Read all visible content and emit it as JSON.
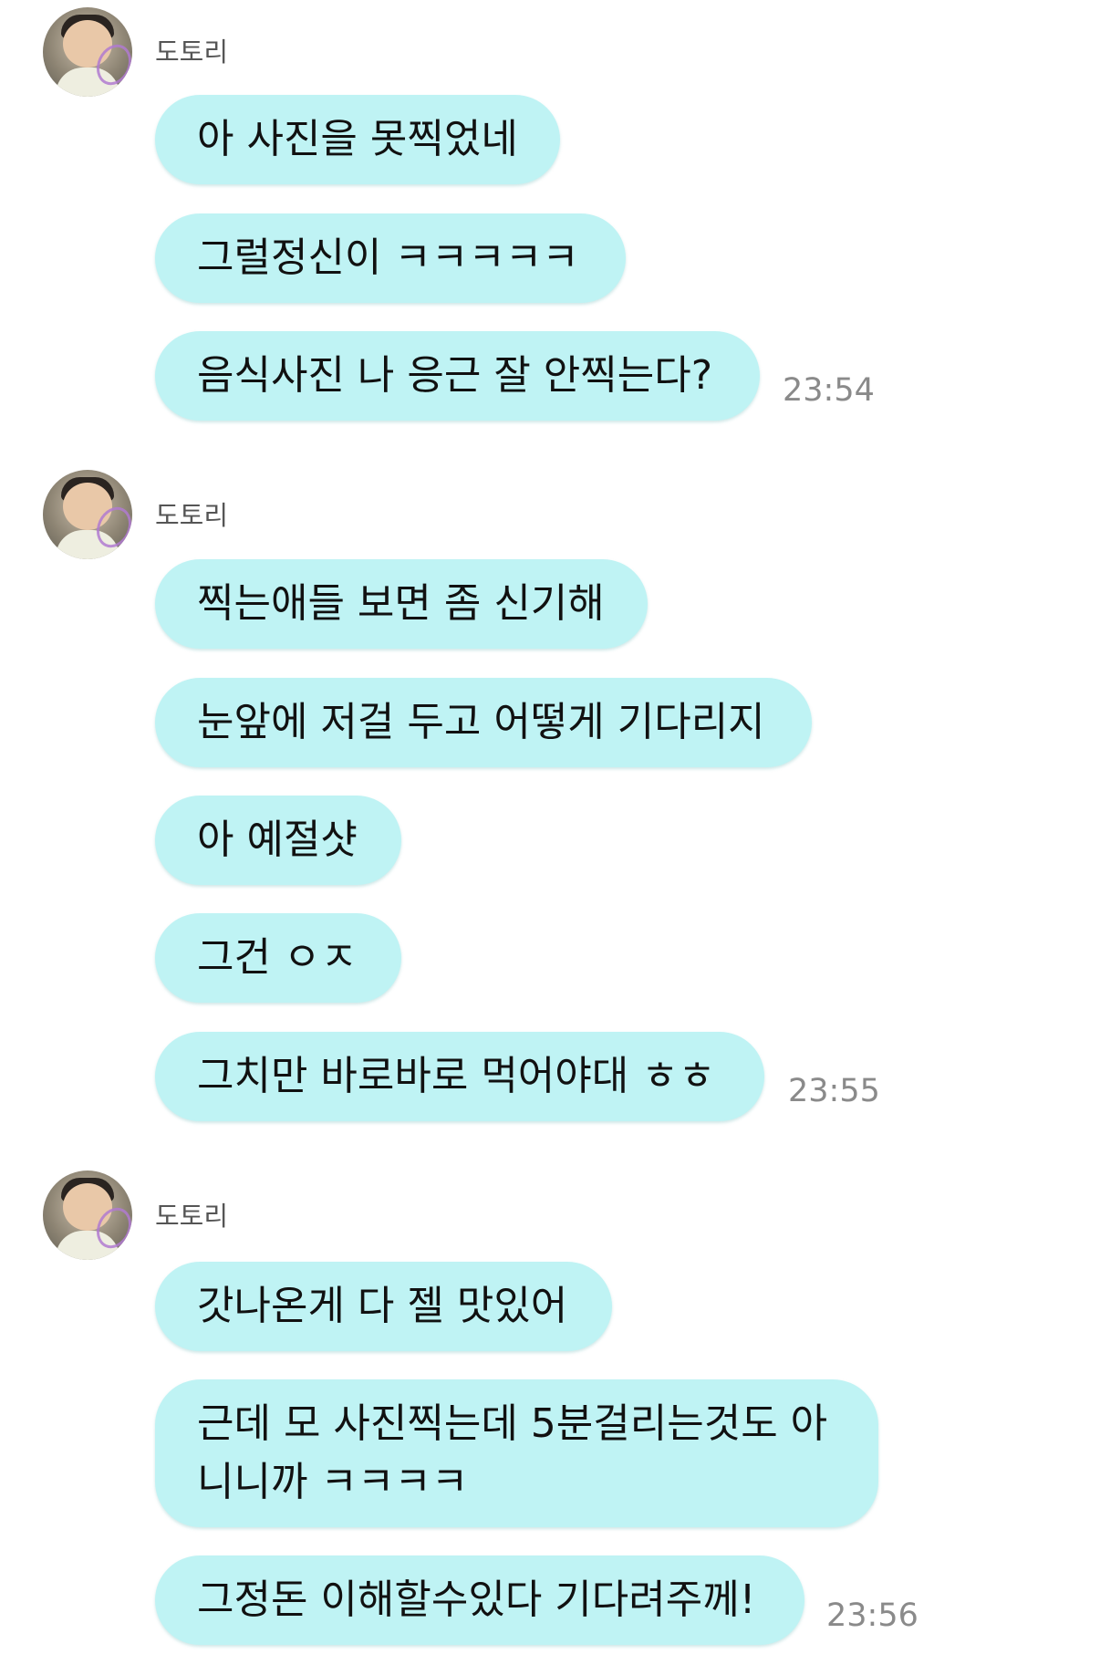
{
  "groups": [
    {
      "sender": "도토리",
      "avatar_icon": "profile-photo",
      "messages": [
        "아 사진을 못찍었네",
        "그럴정신이 ㅋㅋㅋㅋㅋ",
        "음식사진 나 응근 잘 안찍는다?"
      ],
      "time": "23:54"
    },
    {
      "sender": "도토리",
      "avatar_icon": "profile-photo",
      "messages": [
        "찍는애들 보면 좀 신기해",
        "눈앞에 저걸 두고 어떻게 기다리지",
        "아 예절샷",
        "그건 ㅇㅈ",
        "그치만 바로바로 먹어야대 ㅎㅎ"
      ],
      "time": "23:55"
    },
    {
      "sender": "도토리",
      "avatar_icon": "profile-photo",
      "messages": [
        "갓나온게 다 젤 맛있어",
        "근데 모 사진찍는데 5분걸리는것도 아니니까 ㅋㅋㅋㅋ",
        "그정돈 이해할수있다 기다려주께!"
      ],
      "time": "23:56"
    }
  ],
  "colors": {
    "bubble": "#bff3f4",
    "time": "#8a8a8a",
    "name": "#555555"
  }
}
